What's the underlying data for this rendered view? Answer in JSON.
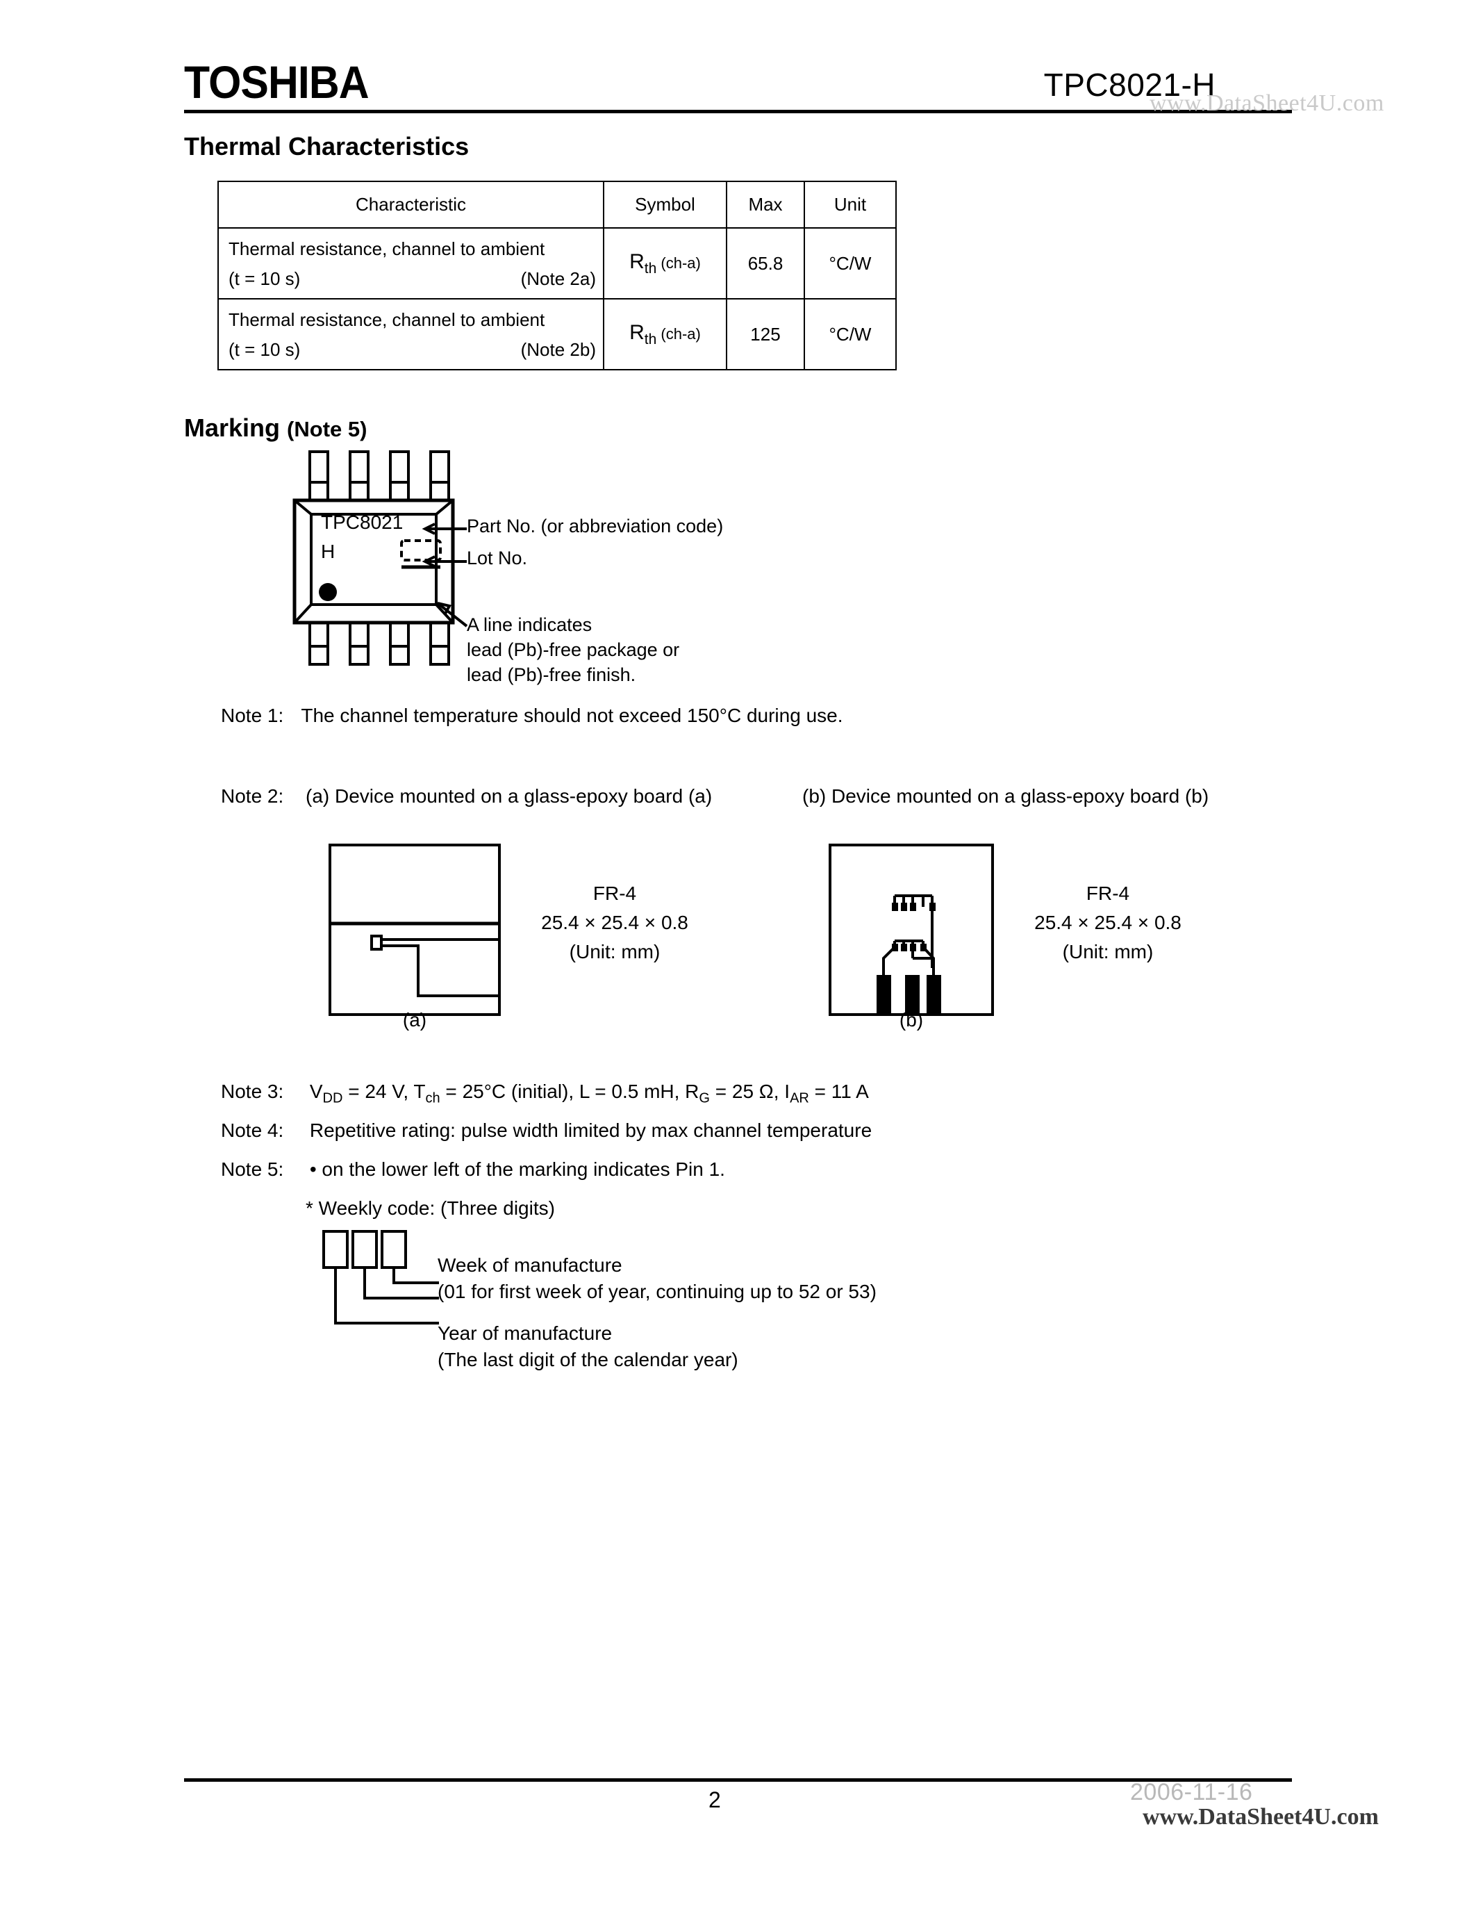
{
  "header": {
    "logo": "TOSHIBA",
    "part_number": "TPC8021-H",
    "watermark": "www.DataSheet4U.com"
  },
  "thermal": {
    "title": "Thermal Characteristics",
    "columns": [
      "Characteristic",
      "Symbol",
      "Max",
      "Unit"
    ],
    "rows": [
      {
        "characteristic_line1": "Thermal resistance, channel to ambient",
        "characteristic_line2": "(t = 10 s)",
        "note_ref": "(Note 2a)",
        "symbol_base": "R",
        "symbol_sub": "th",
        "symbol_paren": "(ch-a)",
        "max": "65.8",
        "unit": "°C/W"
      },
      {
        "characteristic_line1": "Thermal resistance, channel to ambient",
        "characteristic_line2": "(t = 10 s)",
        "note_ref": "(Note 2b)",
        "symbol_base": "R",
        "symbol_sub": "th",
        "symbol_paren": "(ch-a)",
        "max": "125",
        "unit": "°C/W"
      }
    ]
  },
  "marking": {
    "title": "Marking",
    "title_note": "(Note 5)",
    "package_mark_line1": "TPC8021",
    "package_mark_line2": "H",
    "callouts": {
      "part_no": "Part No. (or abbreviation code)",
      "lot_no": "Lot No.",
      "pbfree_line1": "A line indicates",
      "pbfree_line2": "lead (Pb)-free package or",
      "pbfree_line3": "lead (Pb)-free finish."
    }
  },
  "notes": {
    "note1_label": "Note 1:",
    "note1_text": "The channel temperature should not exceed 150°C during use.",
    "note2_label": "Note 2:",
    "note2_a_caption": "(a) Device mounted on a glass-epoxy board (a)",
    "note2_b_caption": "(b) Device mounted on a glass-epoxy board (b)",
    "note3_label": "Note 3:",
    "note3_parts": {
      "v": "V",
      "v_sub": "DD",
      "v_val": " = 24 V, ",
      "t": "T",
      "t_sub": "ch",
      "t_val": " = 25°C (initial), L = 0.5 mH, ",
      "r": "R",
      "r_sub": "G",
      "r_val": " = 25 Ω, ",
      "i": "I",
      "i_sub": "AR",
      "i_val": " = 11 A"
    },
    "note4_label": "Note 4:",
    "note4_text": "Repetitive rating: pulse width limited by max channel temperature",
    "note5_label": "Note 5:",
    "note5_text": "• on the lower left of the marking indicates Pin 1."
  },
  "boards": {
    "a": {
      "material": "FR-4",
      "dimensions": "25.4 × 25.4 × 0.8",
      "unit": "(Unit: mm)",
      "caption": "(a)"
    },
    "b": {
      "material": "FR-4",
      "dimensions": "25.4 × 25.4 × 0.8",
      "unit": "(Unit: mm)",
      "caption": "(b)"
    }
  },
  "weekly_code": {
    "heading": "* Weekly code:  (Three digits)",
    "week_label": "Week of manufacture",
    "week_detail": "(01 for first week of year, continuing up to 52 or 53)",
    "year_label": "Year of manufacture",
    "year_detail": "(The last digit of the calendar year)"
  },
  "footer": {
    "page_number": "2",
    "date": "2006-11-16",
    "watermark": "www.DataSheet4U.com"
  }
}
